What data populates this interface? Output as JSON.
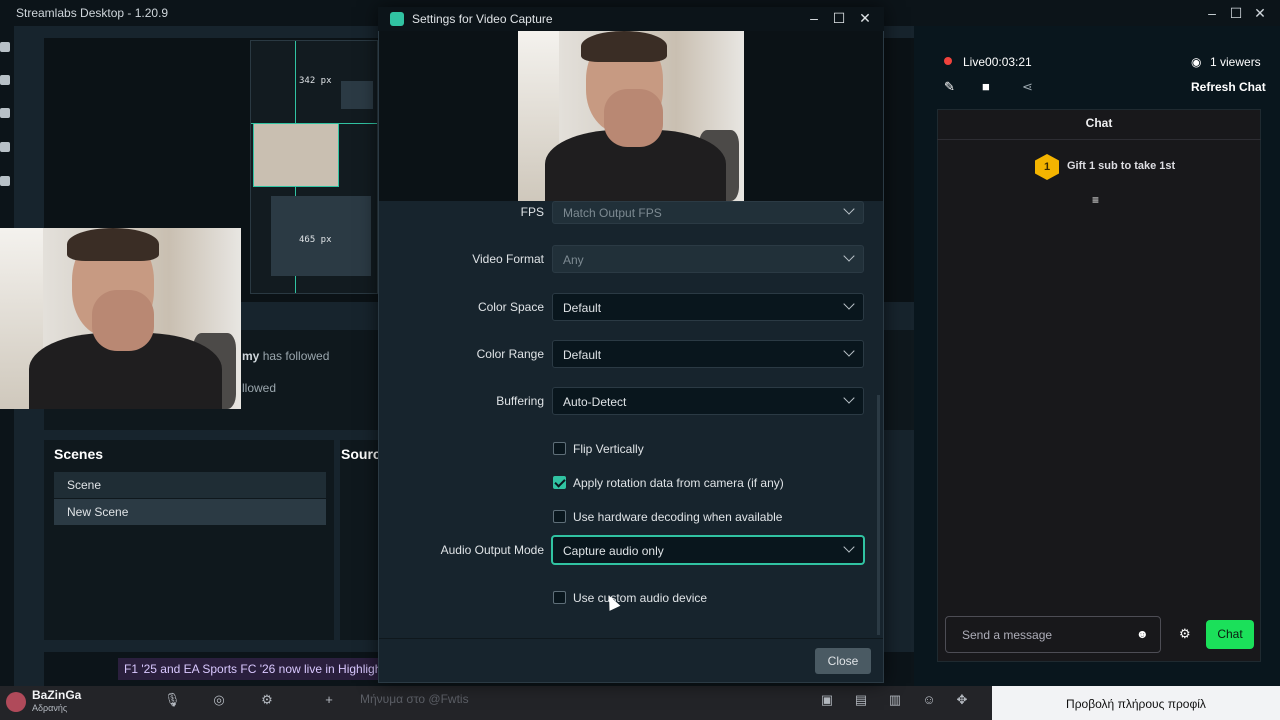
{
  "app": {
    "title": "Streamlabs Desktop - 1.20.9"
  },
  "editor": {
    "measure_top": "342 px",
    "measure_bottom": "465 px"
  },
  "activity": {
    "item1_name": "my",
    "item1_action": "has followed",
    "item2_text": "llowed"
  },
  "scenes": {
    "header": "Scenes",
    "items": [
      "Scene",
      "New Scene"
    ],
    "active_index": 1
  },
  "sources": {
    "header": "Sourc"
  },
  "ticker": {
    "text": "F1 '25 and EA Sports FC '26 now live in Highlight"
  },
  "stream": {
    "live_label": "Live",
    "live_time": "00:03:21",
    "viewers": "1 viewers",
    "refresh_chat": "Refresh Chat"
  },
  "chat": {
    "title": "Chat",
    "gift_rank": "1",
    "gift_text": "Gift 1 sub to take 1st",
    "input_placeholder": "Send a message",
    "send_label": "Chat"
  },
  "dialog": {
    "title": "Settings for Video Capture",
    "fields": {
      "fps": {
        "label": "FPS",
        "value": "Match Output FPS"
      },
      "video_format": {
        "label": "Video Format",
        "value": "Any"
      },
      "color_space": {
        "label": "Color Space",
        "value": "Default"
      },
      "color_range": {
        "label": "Color Range",
        "value": "Default"
      },
      "buffering": {
        "label": "Buffering",
        "value": "Auto-Detect"
      },
      "audio_output_mode": {
        "label": "Audio Output Mode",
        "value": "Capture audio only"
      }
    },
    "checkboxes": {
      "flip_vertically": {
        "label": "Flip Vertically",
        "checked": false
      },
      "apply_rotation": {
        "label": "Apply rotation data from camera (if any)",
        "checked": true
      },
      "hw_decoding": {
        "label": "Use hardware decoding when available",
        "checked": false
      },
      "custom_audio": {
        "label": "Use custom audio device",
        "checked": false
      }
    },
    "close_label": "Close"
  },
  "discord": {
    "username": "BaZinGa",
    "status": "Αδρανής",
    "message_placeholder": "Μήνυμα στο @Fwtis",
    "profile_button": "Προβολή πλήρους προφίλ"
  },
  "colors": {
    "accent": "#31c3a2",
    "live_red": "#f0423c",
    "chat_send": "#1be05a",
    "gift_gold": "#f4b400"
  }
}
